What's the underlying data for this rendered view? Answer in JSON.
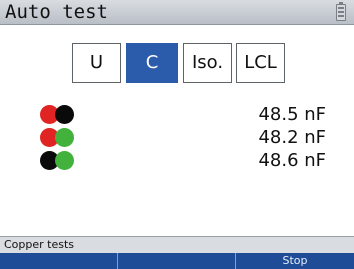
{
  "header": {
    "title": "Auto test",
    "battery_icon": "battery-icon"
  },
  "tabs": [
    {
      "label": "U",
      "active": false
    },
    {
      "label": "C",
      "active": true
    },
    {
      "label": "Iso.",
      "active": false
    },
    {
      "label": "LCL",
      "active": false
    }
  ],
  "measurements": [
    {
      "pair": [
        "red",
        "black"
      ],
      "value": "48.5 nF"
    },
    {
      "pair": [
        "red",
        "green"
      ],
      "value": "48.2 nF"
    },
    {
      "pair": [
        "black",
        "green"
      ],
      "value": "48.6 nF"
    }
  ],
  "status_bar": {
    "text": "Copper tests"
  },
  "softkeys": [
    "",
    "",
    "Stop"
  ],
  "colors": {
    "accent": "#2a5cab",
    "red": "#e02424",
    "black": "#0a0a0a",
    "green": "#43b23c",
    "softkey_bg": "#1f4c97"
  }
}
